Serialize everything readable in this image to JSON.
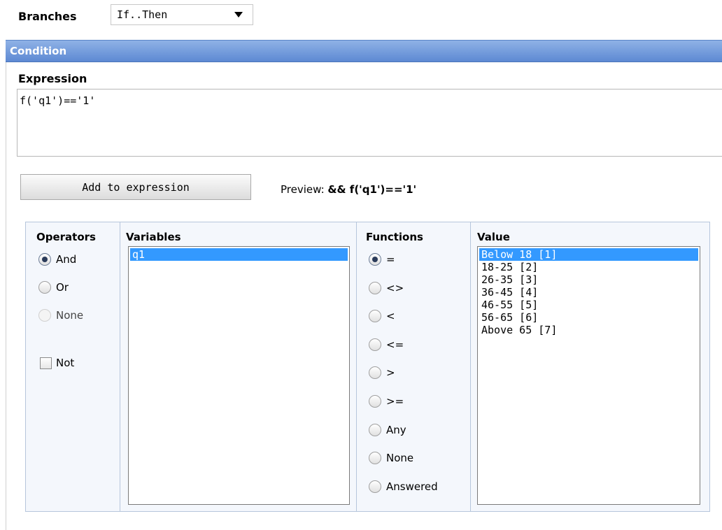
{
  "branches": {
    "label": "Branches",
    "selected": "If..Then"
  },
  "condition": {
    "header": "Condition"
  },
  "expression": {
    "label": "Expression",
    "value": "f('q1')=='1'"
  },
  "add_button": {
    "label": "Add to expression"
  },
  "preview": {
    "label": "Preview:",
    "value": "&& f('q1')=='1'"
  },
  "operators": {
    "heading": "Operators",
    "items": [
      {
        "label": "And",
        "checked": true,
        "disabled": false
      },
      {
        "label": "Or",
        "checked": false,
        "disabled": false
      },
      {
        "label": "None",
        "checked": false,
        "disabled": true
      }
    ],
    "not_label": "Not",
    "not_checked": false
  },
  "variables": {
    "heading": "Variables",
    "items": [
      "q1"
    ],
    "selected_index": 0
  },
  "functions": {
    "heading": "Functions",
    "items": [
      "=",
      "<>",
      "<",
      "<=",
      ">",
      ">=",
      "Any",
      "None",
      "Answered"
    ],
    "selected_index": 0
  },
  "value": {
    "heading": "Value",
    "items": [
      "Below 18 [1]",
      "18-25 [2]",
      "26-35 [3]",
      "36-45 [4]",
      "46-55 [5]",
      "56-65 [6]",
      "Above 65 [7]"
    ],
    "selected_index": 0
  },
  "colors": {
    "header_top": "#8fb2e6",
    "header_bottom": "#5d89d3",
    "selection": "#3399ff",
    "panel_bg": "#f4f7fc"
  }
}
